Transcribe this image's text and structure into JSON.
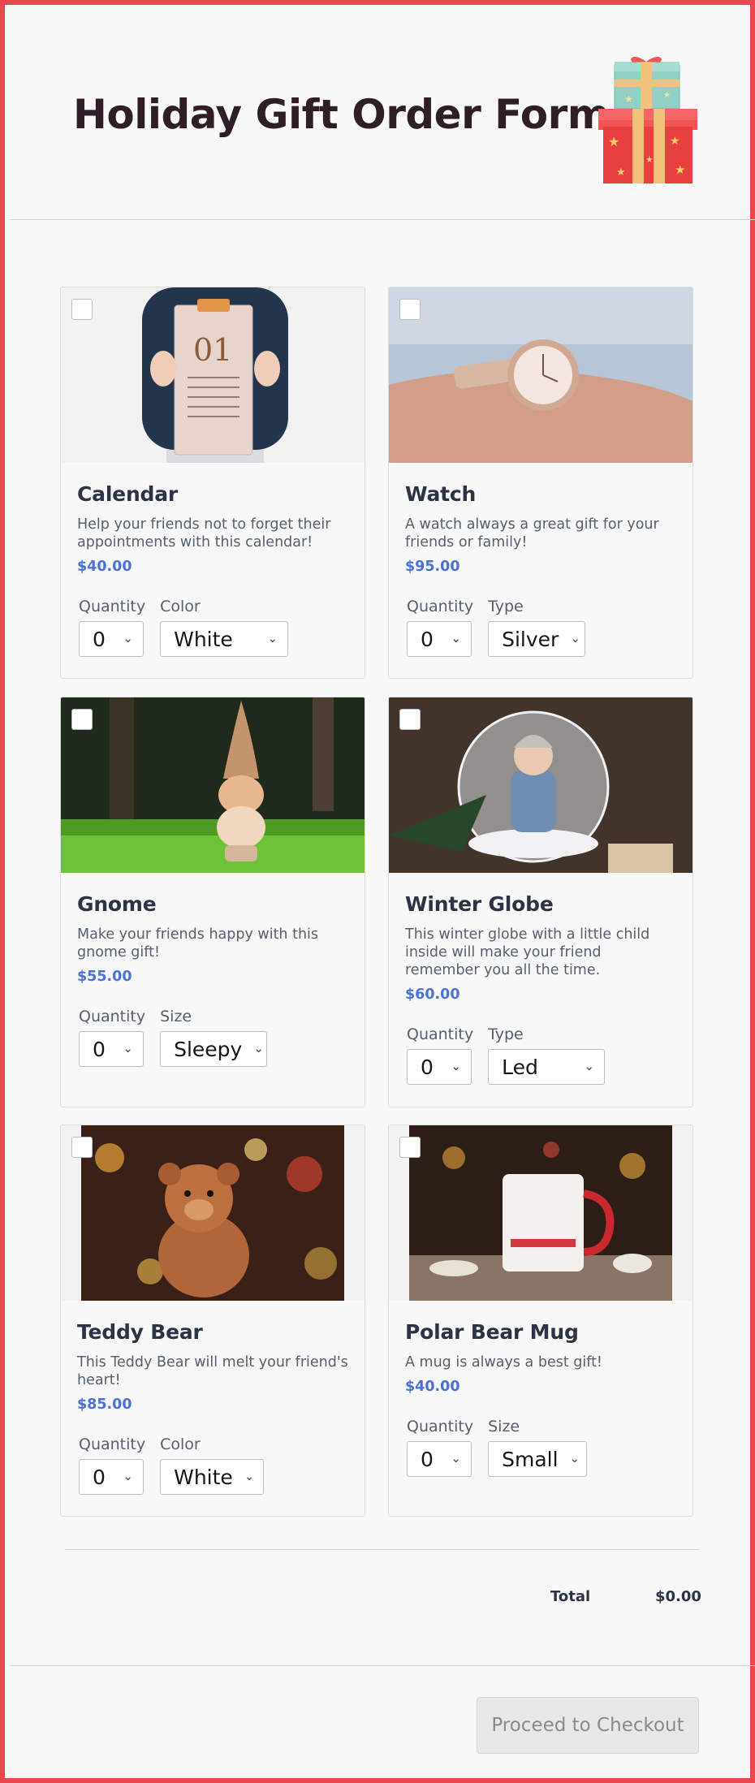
{
  "form": {
    "title": "Holiday Gift Order Form"
  },
  "products": [
    {
      "name": "Calendar",
      "description": "Help your friends not to forget their appointments with this calendar!",
      "price": "$40.00",
      "image_text": "01",
      "options": [
        {
          "label": "Quantity",
          "value": "0"
        },
        {
          "label": "Color",
          "value": "White"
        }
      ]
    },
    {
      "name": "Watch",
      "description": "A watch always a great gift for your friends or family!",
      "price": "$95.00",
      "options": [
        {
          "label": "Quantity",
          "value": "0"
        },
        {
          "label": "Type",
          "value": "Silver"
        }
      ]
    },
    {
      "name": "Gnome",
      "description": "Make your friends happy with this gnome gift!",
      "price": "$55.00",
      "options": [
        {
          "label": "Quantity",
          "value": "0"
        },
        {
          "label": "Size",
          "value": "Sleepy"
        }
      ]
    },
    {
      "name": "Winter Globe",
      "description": "This winter globe with a little child inside will make your friend remember you all the time.",
      "price": "$60.00",
      "options": [
        {
          "label": "Quantity",
          "value": "0"
        },
        {
          "label": "Type",
          "value": "Led"
        }
      ]
    },
    {
      "name": "Teddy Bear",
      "description": "This Teddy Bear will melt your friend's heart!",
      "price": "$85.00",
      "options": [
        {
          "label": "Quantity",
          "value": "0"
        },
        {
          "label": "Color",
          "value": "White"
        }
      ]
    },
    {
      "name": "Polar Bear Mug",
      "description": "A mug is always a best gift!",
      "price": "$40.00",
      "options": [
        {
          "label": "Quantity",
          "value": "0"
        },
        {
          "label": "Size",
          "value": "Small"
        }
      ]
    }
  ],
  "summary": {
    "total_label": "Total",
    "total_value": "$0.00"
  },
  "checkout": {
    "label": "Proceed to Checkout"
  },
  "colors": {
    "frame_border": "#e8484e",
    "price": "#4a72d6",
    "title": "#2f1e25"
  }
}
